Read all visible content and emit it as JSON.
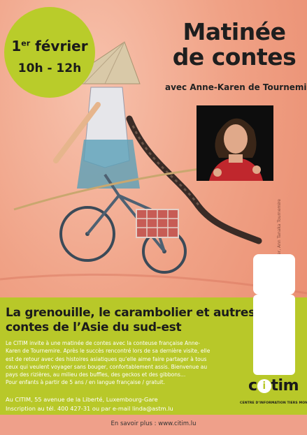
{
  "badge": {
    "date_day": "1",
    "date_sup": "er",
    "date_month": " février",
    "time": "10h - 12h"
  },
  "title": {
    "line1": "Matinée",
    "line2": "de contes"
  },
  "subtitle": "avec Anne-Karen de Tournemire",
  "credit": "Dessin: Marie Sellier, Ann Tanaka Tournemire",
  "panel": {
    "heading_line1": "La grenouille, le carambolier et autres",
    "heading_line2": "contes de l’Asie du sud-est",
    "body": [
      "Le CITIM invite à une matinée de contes avec la conteuse française Anne-",
      "Karen de Tournemire. Après le succès rencontré lors de sa dernière visite, elle",
      "est de retour avec des histoires asiatiques qu’elle aime faire partager à tous",
      "ceux qui veulent voyager sans bouger, confortablement assis. Bienvenue au",
      "pays des rizières, au milieu des buffles, des geckos et des gibbons…",
      "Pour enfants à partir de 5 ans / en langue française / gratuit."
    ],
    "address_line1": "Au CITIM, 55 avenue de la Liberté, Luxembourg-Gare",
    "address_line2": "Inscription au tél. 400 427-31 ou par e-mail linda@astm.lu"
  },
  "logo": {
    "text_c": "c",
    "text_i": "i",
    "text_rest": "tim",
    "subtitle": "CENTRE D’INFORMATION TIERS MONDE"
  },
  "footer": {
    "link": "En savoir plus : www.citim.lu"
  },
  "colors": {
    "accent_green": "#b8c829",
    "background": "#f0a286"
  }
}
